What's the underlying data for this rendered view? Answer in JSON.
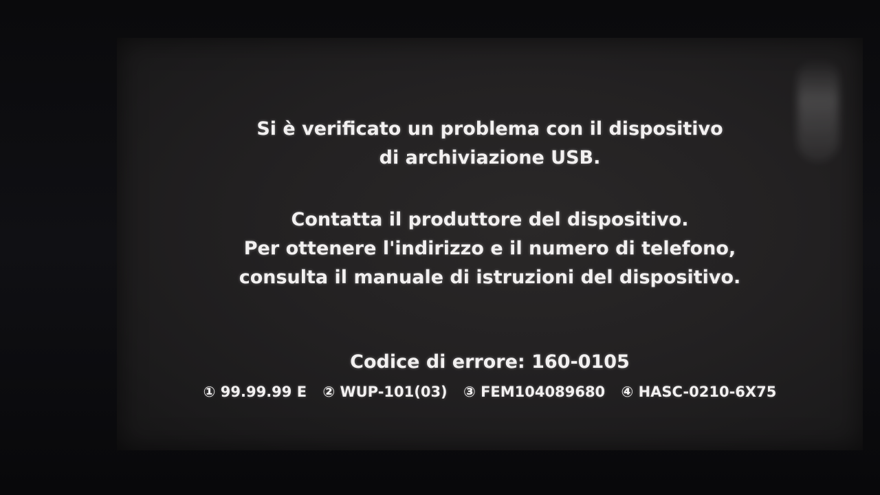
{
  "error_message": {
    "paragraph_1": [
      "Si è verificato un problema con il dispositivo",
      "di archiviazione USB."
    ],
    "paragraph_2": [
      "Contatta il produttore del dispositivo.",
      "Per ottenere l'indirizzo e il numero di telefono,",
      "consulta il manuale di istruzioni del dispositivo."
    ],
    "error_code": "Codice di errore: 160-0105",
    "details": [
      "① 99.99.99 E",
      "② WUP-101(03)",
      "③ FEM104089680",
      "④ HASC-0210-6X75"
    ]
  }
}
